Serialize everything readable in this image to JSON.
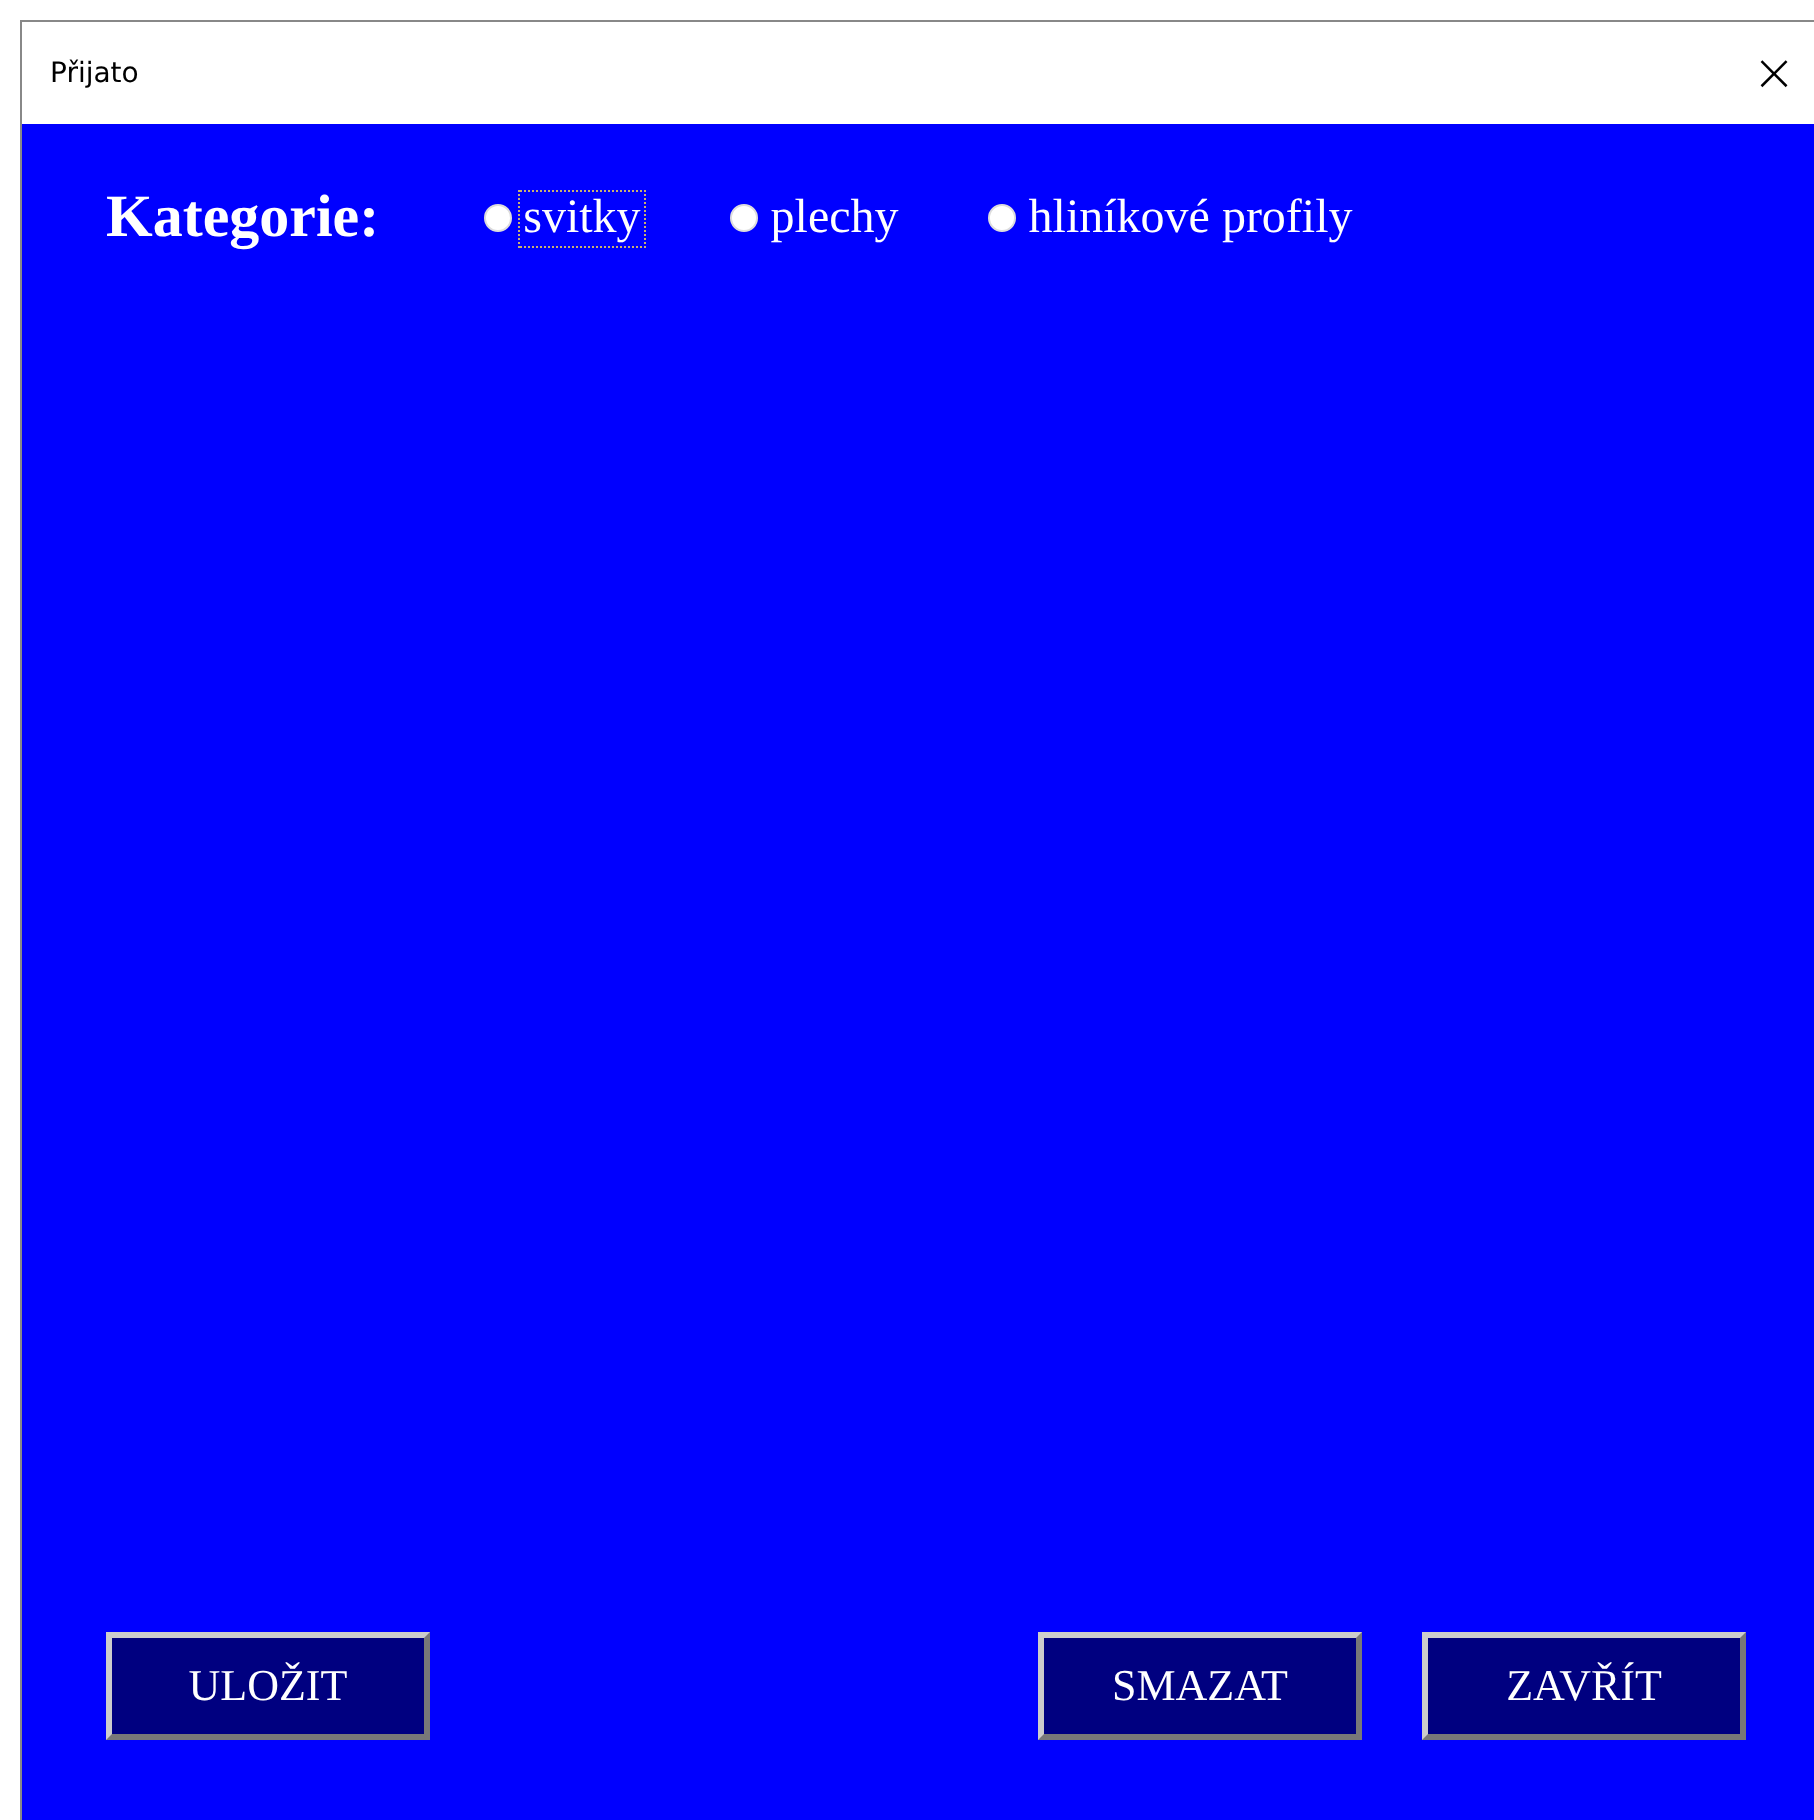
{
  "window": {
    "title": "Přijato",
    "close": "×"
  },
  "category": {
    "label": "Kategorie:",
    "options": [
      {
        "label": "svitky",
        "selected": false,
        "focused": true
      },
      {
        "label": "plechy",
        "selected": false,
        "focused": false
      },
      {
        "label": "hliníkové profily",
        "selected": false,
        "focused": false
      }
    ]
  },
  "buttons": {
    "left": [
      "ULOŽIT"
    ],
    "right": [
      "SMAZAT",
      "ZAVŘÍT"
    ]
  }
}
